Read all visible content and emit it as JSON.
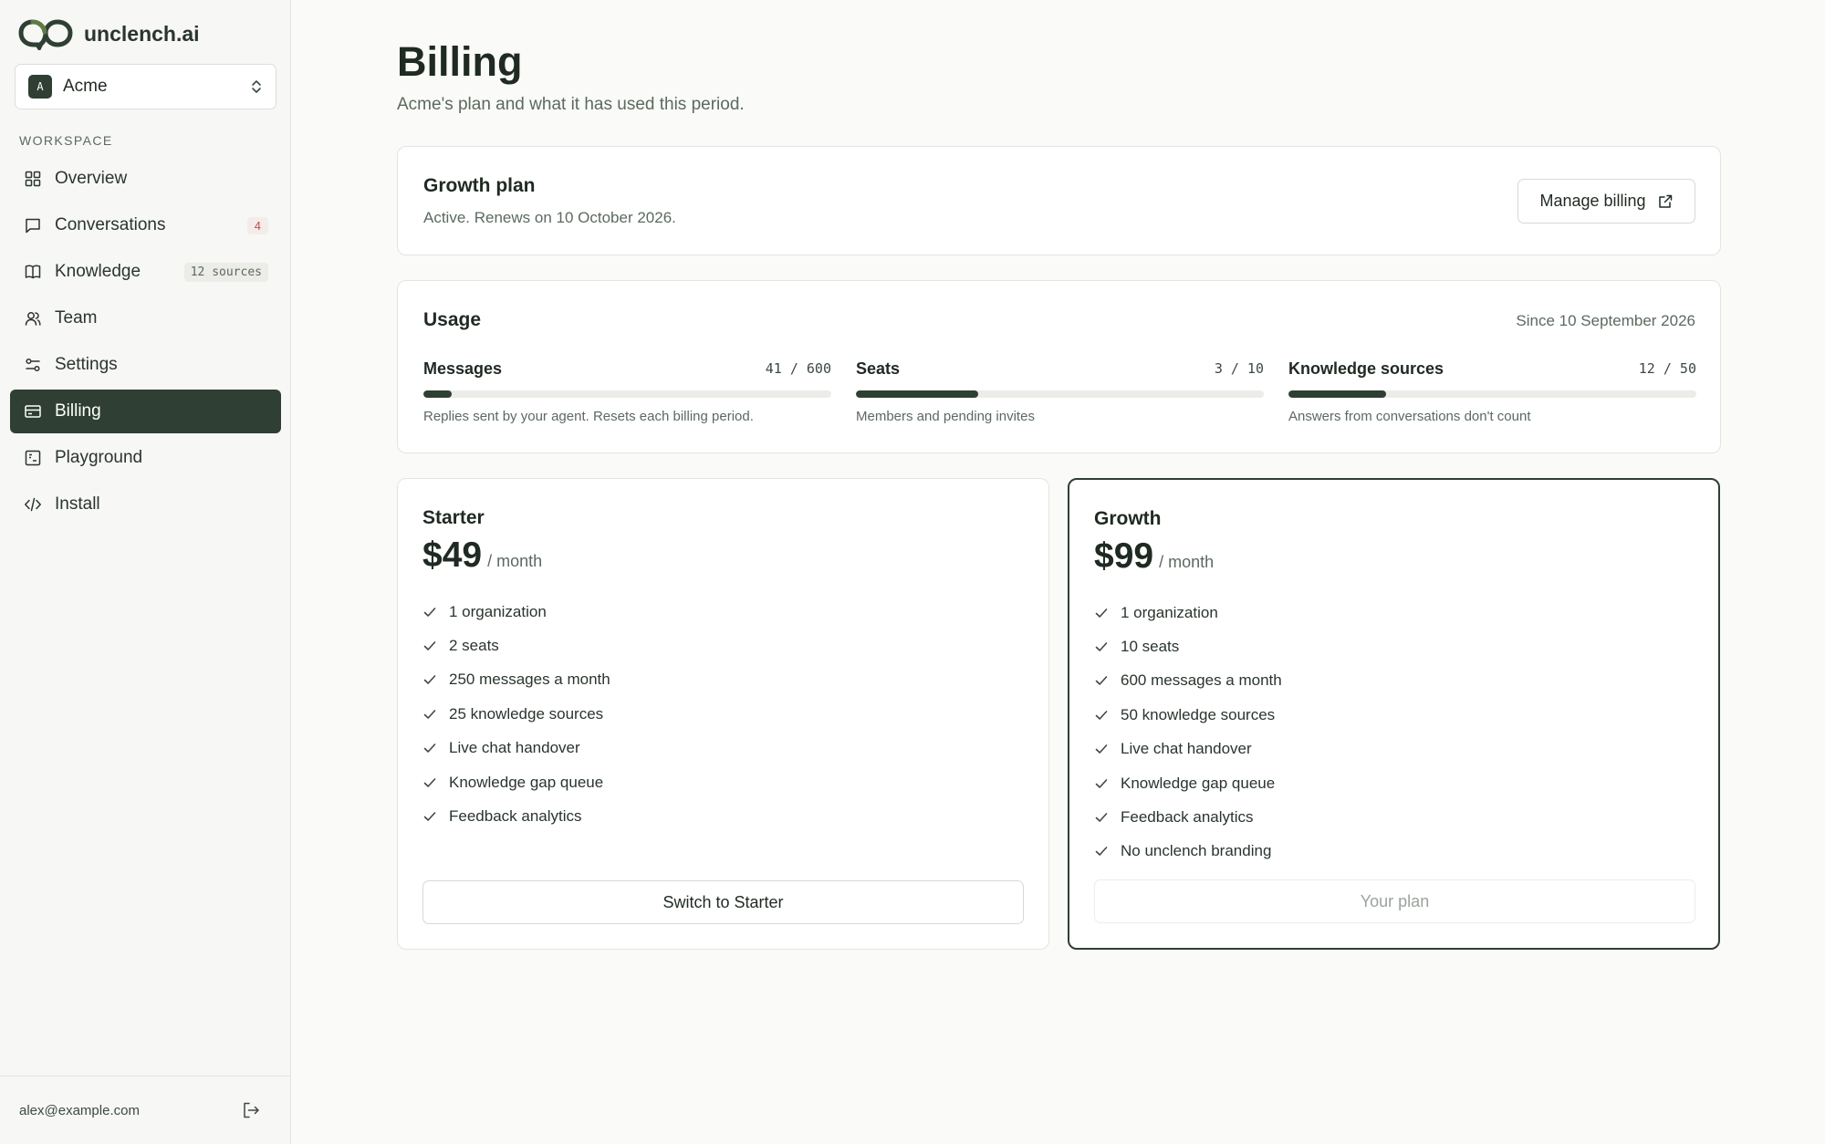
{
  "sidebar": {
    "brand": "unclench.ai",
    "org": {
      "initial": "A",
      "name": "Acme"
    },
    "section_label": "WORKSPACE",
    "items": [
      {
        "label": "Overview",
        "icon": "grid-icon"
      },
      {
        "label": "Conversations",
        "icon": "chat-icon",
        "badge": "4"
      },
      {
        "label": "Knowledge",
        "icon": "book-icon",
        "badge": "12 sources"
      },
      {
        "label": "Team",
        "icon": "users-icon"
      },
      {
        "label": "Settings",
        "icon": "sliders-icon"
      },
      {
        "label": "Billing",
        "icon": "credit-card-icon",
        "active": true
      },
      {
        "label": "Playground",
        "icon": "playground-icon"
      },
      {
        "label": "Install",
        "icon": "code-icon"
      }
    ],
    "user_email": "alex@example.com"
  },
  "page": {
    "title": "Billing",
    "subtitle": "Acme's plan and what it has used this period."
  },
  "plan": {
    "title": "Growth plan",
    "status": "Active. Renews on 10 October 2026.",
    "manage_label": "Manage billing"
  },
  "usage": {
    "title": "Usage",
    "since": "Since 10 September 2026",
    "meters": [
      {
        "name": "Messages",
        "value": "41 / 600",
        "used": 41,
        "limit": 600,
        "note": "Replies sent by your agent. Resets each billing period."
      },
      {
        "name": "Seats",
        "value": "3 / 10",
        "used": 3,
        "limit": 10,
        "note": "Members and pending invites"
      },
      {
        "name": "Knowledge sources",
        "value": "12 / 50",
        "used": 12,
        "limit": 50,
        "note": "Answers from conversations don't count"
      }
    ]
  },
  "tiers": [
    {
      "name": "Starter",
      "price": "$49",
      "period": "/ month",
      "features": [
        "1 organization",
        "2 seats",
        "250 messages a month",
        "25 knowledge sources",
        "Live chat handover",
        "Knowledge gap queue",
        "Feedback analytics"
      ],
      "button": "Switch to Starter",
      "current": false
    },
    {
      "name": "Growth",
      "price": "$99",
      "period": "/ month",
      "features": [
        "1 organization",
        "10 seats",
        "600 messages a month",
        "50 knowledge sources",
        "Live chat handover",
        "Knowledge gap queue",
        "Feedback analytics",
        "No unclench branding"
      ],
      "button": "Your plan",
      "current": true
    }
  ],
  "colors": {
    "accent": "#2f3f33",
    "badge_red": "#c0504a"
  }
}
